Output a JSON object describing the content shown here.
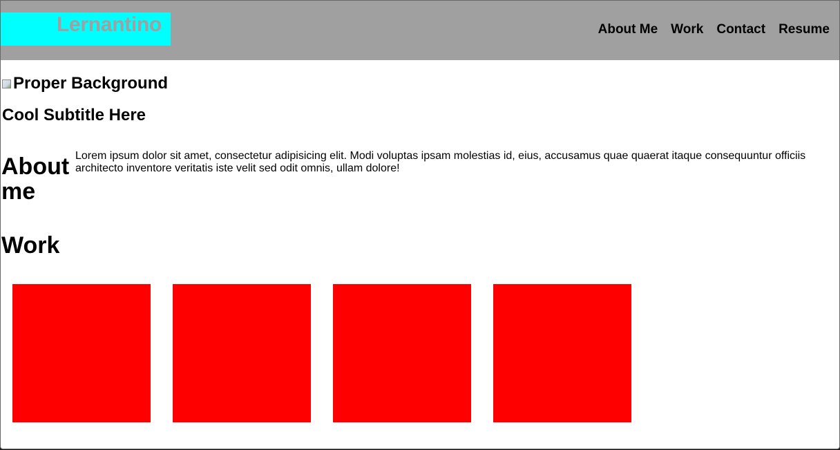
{
  "header": {
    "logo": "Lernantino",
    "nav": [
      "About Me",
      "Work",
      "Contact",
      "Resume"
    ]
  },
  "hero": {
    "image_alt": "Proper Background",
    "subtitle": "Cool Subtitle Here"
  },
  "about": {
    "heading": "About me",
    "text": "Lorem ipsum dolor sit amet, consectetur adipisicing elit. Modi voluptas ipsam molestias id, eius, accusamus quae quaerat itaque consequuntur officiis architecto inventore veritatis iste velit sed odit omnis, ullam dolore!"
  },
  "work": {
    "heading": "Work",
    "item_count": 4
  },
  "colors": {
    "header_bg": "#a0a0a0",
    "logo_bg": "#00ffff",
    "work_item": "#ff0000",
    "page_bg": "#ffffff"
  },
  "icons": {
    "broken_image": "broken-image-icon"
  }
}
